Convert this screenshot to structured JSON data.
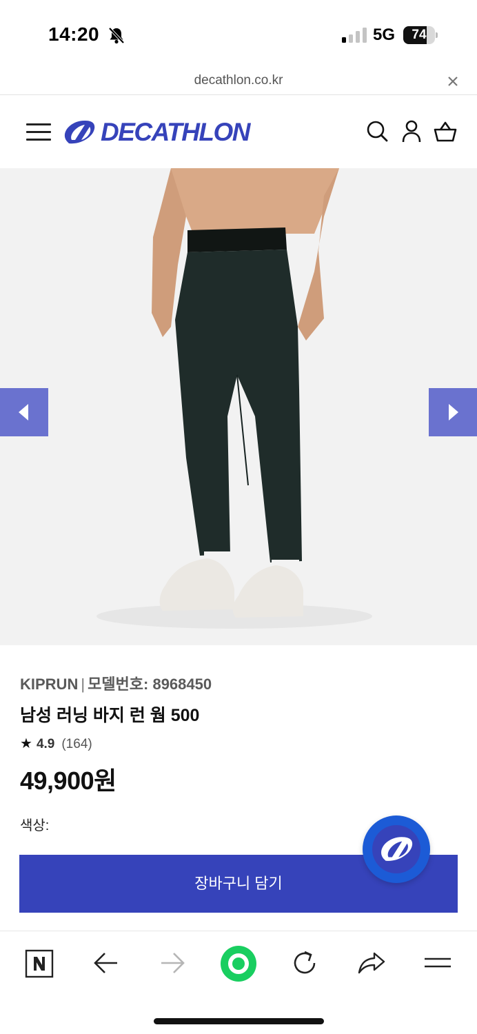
{
  "status_bar": {
    "time": "14:20",
    "network": "5G",
    "battery_level": "74",
    "battery_fraction": 0.74,
    "icons": [
      "bell-slash-icon",
      "signal-icon",
      "battery-icon"
    ]
  },
  "browser": {
    "url": "decathlon.co.kr",
    "close_icon": "close-icon"
  },
  "header": {
    "logo_text": "DECATHLON",
    "brand_color": "#3643ba",
    "icons": [
      "menu-icon",
      "search-icon",
      "account-icon",
      "basket-icon"
    ]
  },
  "gallery": {
    "prev_icon": "chevron-left-icon",
    "next_icon": "chevron-right-icon",
    "arrow_color": "#6a72cf"
  },
  "product": {
    "brand": "KIPRUN",
    "separator": "|",
    "model_label": "모델번호: 8968450",
    "title": "남성 러닝 바지 런 웜 500",
    "rating_star": "★",
    "rating_score": "4.9",
    "rating_count": "(164)",
    "price": "49,900원",
    "color_label": "색상:"
  },
  "cart": {
    "add_label": "장바구니 담기",
    "button_color": "#3643ba"
  },
  "fab": {
    "icon": "decathlon-logo-icon"
  },
  "toolbar": {
    "items": [
      "naver-icon",
      "back-arrow-icon",
      "forward-arrow-icon",
      "green-dot-icon",
      "refresh-icon",
      "share-icon",
      "menu-icon"
    ],
    "accent_color": "#19ce60"
  }
}
